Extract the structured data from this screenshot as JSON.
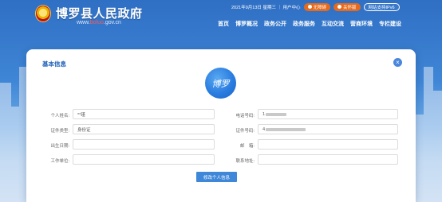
{
  "header": {
    "site_title": "博罗县人民政府",
    "domain_prefix": "www.",
    "domain_mask": "boluo",
    "domain_suffix": ".gov.cn",
    "date_text": "2021年9月13日 星期三 ｜ 用户中心",
    "btn_elder": "无障碍",
    "btn_care": "关怀版",
    "btn_ipv6": "网站支持IPv6"
  },
  "nav": {
    "items": [
      "首页",
      "博罗概况",
      "政务公开",
      "政务服务",
      "互动交流",
      "营商环境",
      "专栏建设"
    ]
  },
  "modal": {
    "title": "基本信息",
    "close_icon": "×",
    "avatar_text": "博罗",
    "submit_label": "修改个人信息"
  },
  "form": {
    "name_label": "个人姓名:",
    "name_value": "**瑾",
    "phone_label": "电话号码:",
    "phone_value": "1",
    "id_type_label": "证件类型:",
    "id_type_value": "身份证",
    "id_no_label": "证件号码:",
    "id_no_value": "4",
    "birth_label": "出生日期:",
    "birth_value": "",
    "email_label": "邮　箱:",
    "email_value": "",
    "work_label": "工作单位:",
    "work_value": "",
    "address_label": "联系地址:",
    "address_value": ""
  },
  "colors": {
    "brand_blue": "#1d5fb8",
    "accent_orange": "#e66a1c"
  }
}
